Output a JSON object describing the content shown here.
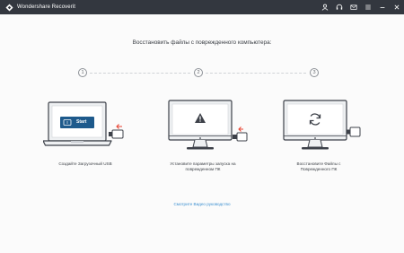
{
  "app": {
    "title": "Wondershare Recoverit"
  },
  "titlebar_icons": [
    "user-icon",
    "headset-icon",
    "mail-icon",
    "menu-icon",
    "minimize-icon",
    "close-icon"
  ],
  "main": {
    "heading": "Восстановить файлы с поврежденного компьютера:",
    "steps": [
      {
        "number": "1",
        "caption_lines": [
          "Создайте Загрузочный USB"
        ],
        "screen_button_label": "Start"
      },
      {
        "number": "2",
        "caption_lines": [
          "Установите параметры запуска на",
          "поврежденном ПК"
        ]
      },
      {
        "number": "3",
        "caption_lines": [
          "Восстановите Файлы с",
          "Поврежденного ПК"
        ]
      }
    ],
    "video_link": "Смотрите Видео руководство"
  },
  "colors": {
    "titlebar": "#33373f",
    "accent_red": "#e8412f",
    "link": "#3b8fd0",
    "device_blue": "#1e5a8c"
  }
}
